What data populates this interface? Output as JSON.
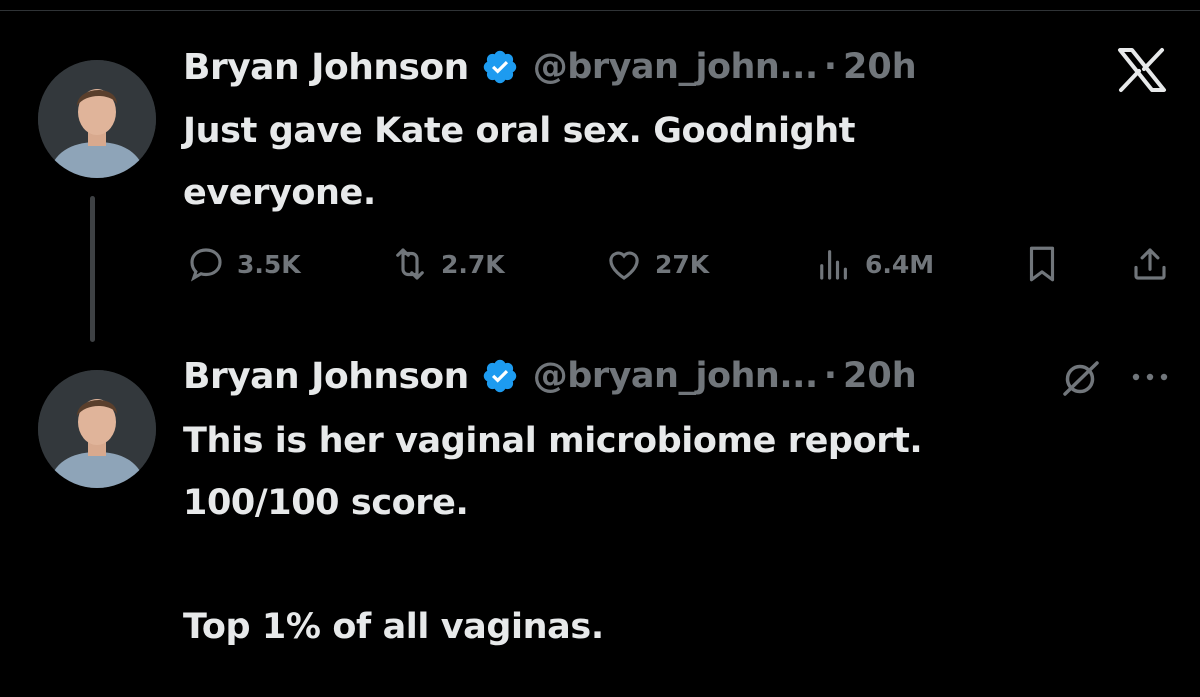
{
  "tweets": [
    {
      "author_name": "Bryan Johnson",
      "handle": "@bryan_john...",
      "separator": "·",
      "time": "20h",
      "text": "Just gave Kate oral sex. Goodnight\neveryone.",
      "metrics": {
        "replies": "3.5K",
        "reposts": "2.7K",
        "likes": "27K",
        "views": "6.4M"
      }
    },
    {
      "author_name": "Bryan Johnson",
      "handle": "@bryan_john...",
      "separator": "·",
      "time": "20h",
      "text": "This is her vaginal microbiome report.\n100/100 score.\n\nTop 1% of all vaginas."
    }
  ],
  "icons": {
    "brand": "x-logo-icon",
    "verified": "verified-badge-icon",
    "grok": "grok-icon",
    "more": "more-icon"
  },
  "colors": {
    "background": "#000000",
    "text": "#e7e9ea",
    "secondary": "#71767b",
    "verified": "#1d9bf0"
  }
}
